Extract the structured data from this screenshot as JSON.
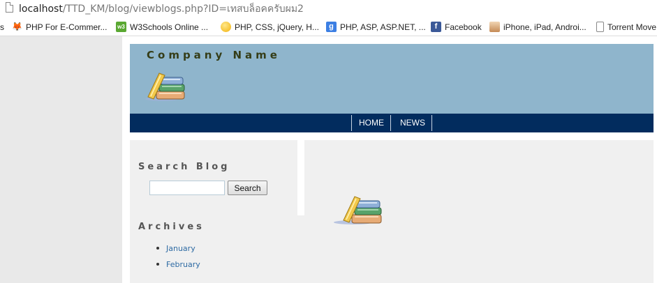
{
  "browser": {
    "url_host": "localhost",
    "url_path": "/TTD_KM/blog/viewblogs.php?ID=เทสบล็อคครับผม2",
    "bookmarks": [
      {
        "label": "s",
        "icon": ""
      },
      {
        "label": "PHP For E-Commer...",
        "icon": "fox-icon"
      },
      {
        "label": "W3Schools Online ...",
        "icon": "w3schools-icon"
      },
      {
        "label": "PHP, CSS, jQuery, H...",
        "icon": "bulb-icon"
      },
      {
        "label": "PHP, ASP, ASP.NET, ...",
        "icon": "google-icon"
      },
      {
        "label": "Facebook",
        "icon": "facebook-icon"
      },
      {
        "label": "iPhone, iPad, Androi...",
        "icon": "box-icon"
      },
      {
        "label": "Torrent Move",
        "icon": "page-icon"
      }
    ]
  },
  "header": {
    "company_name": "Company Name",
    "logo": "books-icon"
  },
  "nav": {
    "home": "HOME",
    "news": "NEWS"
  },
  "sidebar": {
    "search_title": "Search Blog",
    "search_value": "",
    "search_button": "Search",
    "archives_title": "Archives",
    "archives": [
      "January",
      "February"
    ]
  },
  "colors": {
    "header_bg": "#8fb5cc",
    "nav_bg": "#022c5e",
    "company_text": "#353d18",
    "link": "#2d6aa3"
  }
}
